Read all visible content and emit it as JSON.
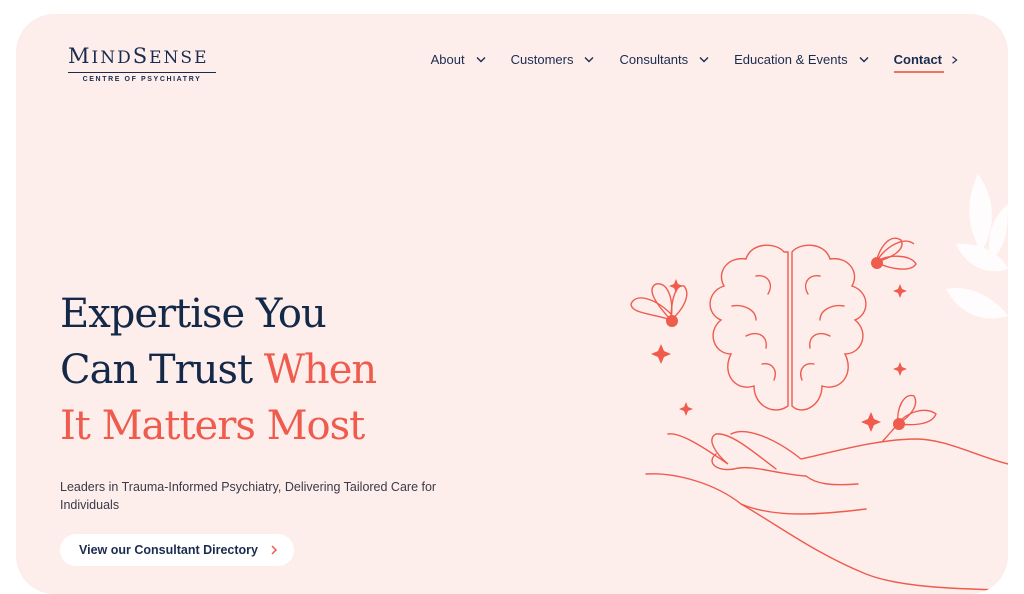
{
  "brand": {
    "name": "MindSense",
    "tagline": "CENTRE OF PSYCHIATRY"
  },
  "nav": {
    "items": [
      {
        "label": "About"
      },
      {
        "label": "Customers"
      },
      {
        "label": "Consultants"
      },
      {
        "label": "Education & Events"
      },
      {
        "label": "Contact"
      }
    ]
  },
  "hero": {
    "headline_line1": "Expertise You",
    "headline_line2_a": "Can Trust ",
    "headline_line2_b": "When",
    "headline_line3": "It Matters Most",
    "subtitle": "Leaders in Trauma-Informed Psychiatry, Delivering Tailored Care for Individuals",
    "cta_label": "View our Consultant Directory"
  },
  "colors": {
    "background": "#fdeeec",
    "navy": "#142848",
    "coral": "#ef5b4d"
  },
  "icons": [
    "chevron-down-icon",
    "chevron-right-icon",
    "brain-in-hands-illustration"
  ]
}
